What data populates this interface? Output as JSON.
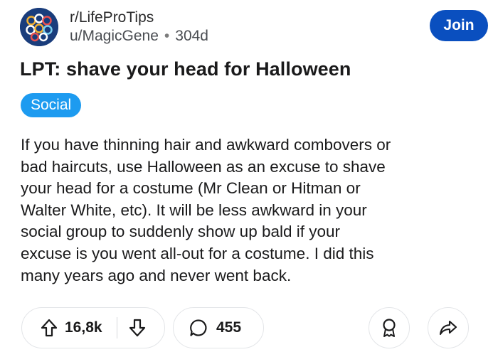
{
  "header": {
    "subreddit": "r/LifeProTips",
    "username": "u/MagicGene",
    "separator": "•",
    "age": "304d",
    "join_label": "Join"
  },
  "post": {
    "title": "LPT: shave your head for Halloween",
    "flair": "Social",
    "body_lines": [
      "If you have thinning hair and awkward combovers or",
      "bad haircuts, use Halloween as an excuse to shave",
      "your head for a costume (Mr Clean or Hitman or",
      "Walter White, etc). It will be less awkward in your",
      "social group to suddenly show up bald if your",
      "excuse is you went all-out for a costume. I did this",
      "many years ago and never went back."
    ]
  },
  "actions": {
    "upvotes": "16,8k",
    "comments": "455",
    "icons": [
      "upvote-icon",
      "downvote-icon",
      "comment-icon",
      "award-icon",
      "share-icon"
    ]
  },
  "colors": {
    "join_button": "#0a4fbf",
    "flair": "#1d9bf0",
    "avatar_bg": "#1a3d7c",
    "text": "#1a1a1b"
  }
}
